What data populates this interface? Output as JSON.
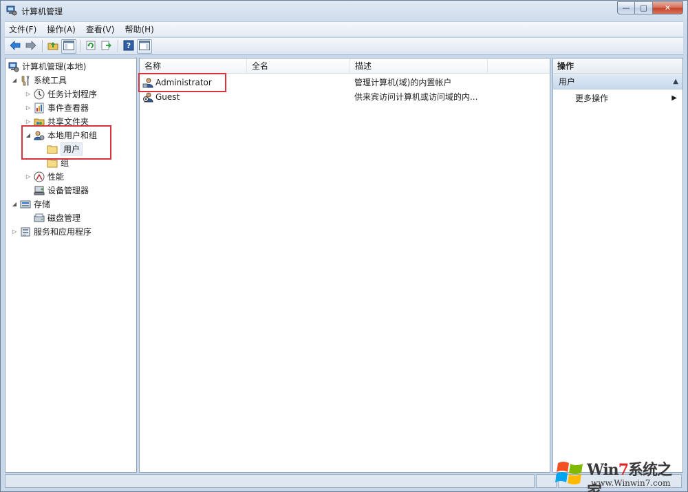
{
  "window": {
    "title": "计算机管理"
  },
  "menu": [
    "文件(F)",
    "操作(A)",
    "查看(V)",
    "帮助(H)"
  ],
  "tree": {
    "root": "计算机管理(本地)",
    "system_tools": "系统工具",
    "task_scheduler": "任务计划程序",
    "event_viewer": "事件查看器",
    "shared_folders": "共享文件夹",
    "local_users_groups": "本地用户和组",
    "users": "用户",
    "groups": "组",
    "performance": "性能",
    "device_manager": "设备管理器",
    "storage": "存储",
    "disk_management": "磁盘管理",
    "services_apps": "服务和应用程序"
  },
  "list": {
    "columns": [
      "名称",
      "全名",
      "描述"
    ],
    "rows": [
      {
        "name": "Administrator",
        "full_name": "",
        "description": "管理计算机(域)的内置帐户"
      },
      {
        "name": "Guest",
        "full_name": "",
        "description": "供来宾访问计算机或访问域的内..."
      }
    ]
  },
  "actions": {
    "header": "操作",
    "section": "用户",
    "more": "更多操作"
  },
  "watermark": {
    "brand_prefix": "Win",
    "brand_seven": "7",
    "brand_suffix": "系统之家",
    "url": "www.Winwin7.com"
  },
  "colors": {
    "highlight": "#d8333d",
    "accent": "#3a7bd5"
  }
}
